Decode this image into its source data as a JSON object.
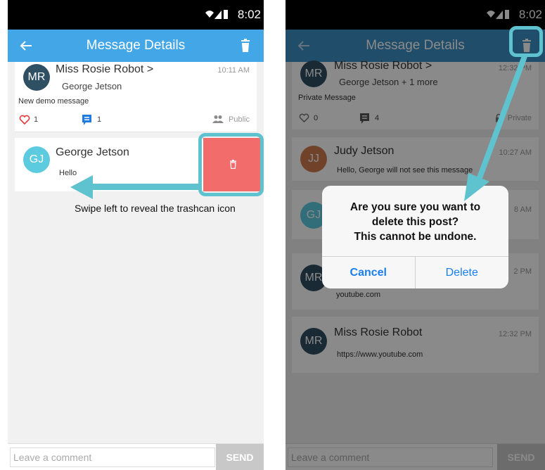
{
  "colors": {
    "accent": "#43a6e6",
    "highlight": "#5ec3cf",
    "delete_red": "#f26c6c",
    "link_blue": "#1a7ef0"
  },
  "left_phone": {
    "status_time": "8:02",
    "title": "Message Details",
    "cards": [
      {
        "initials": "MR",
        "name": "Miss Rosie Robot >",
        "recipient": "George Jetson",
        "timestamp": "10:11 AM",
        "message": "New demo message",
        "likes": "1",
        "comments": "1",
        "visibility": "Public"
      },
      {
        "initials": "GJ",
        "name": "George Jetson",
        "message": "Hello"
      }
    ],
    "hint": "Swipe left to reveal the trashcan icon",
    "composer": {
      "placeholder": "Leave a comment",
      "send_label": "SEND"
    }
  },
  "right_phone": {
    "status_time": "8:02",
    "title": "Message Details",
    "cards": [
      {
        "initials": "MR",
        "name": "Miss Rosie Robot >",
        "recipient": "George Jetson + 1 more",
        "timestamp": "12:32 PM",
        "message": "Private Message",
        "likes": "0",
        "comments": "4",
        "visibility": "Private"
      },
      {
        "initials": "JJ",
        "name": "Judy Jetson",
        "timestamp": "10:27 AM",
        "message": "Hello, George will not see this message"
      },
      {
        "initials": "GJ",
        "timestamp": "8 AM"
      },
      {
        "initials": "MR",
        "timestamp": "2 PM",
        "message": "youtube.com"
      },
      {
        "initials": "MR",
        "name": "Miss Rosie Robot",
        "timestamp": "12:32 PM",
        "message": "https://www.youtube.com"
      }
    ],
    "dialog": {
      "line1": "Are you sure you want to",
      "line2": "delete this post?",
      "line3": "This cannot be undone.",
      "cancel": "Cancel",
      "delete": "Delete"
    },
    "composer": {
      "placeholder": "Leave a comment",
      "send_label": "SEND"
    }
  }
}
